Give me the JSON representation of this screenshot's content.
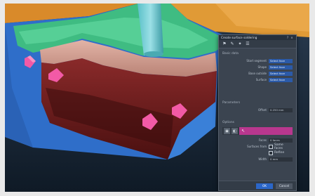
{
  "dialog": {
    "title": "Create surface soldering",
    "controls": [
      "?",
      "×"
    ],
    "toolbar": [
      "flag-icon",
      "pin-icon",
      "wrench-icon",
      "list-icon"
    ],
    "sections": {
      "main": {
        "header": "Basic data",
        "rows": [
          {
            "label": "Start segment",
            "value": "Select face"
          },
          {
            "label": "Shape",
            "value": "Select face"
          },
          {
            "label": "Base outside",
            "value": "Select face"
          },
          {
            "label": "Surface",
            "value": "Select face"
          }
        ]
      },
      "parameters": {
        "header": "Parameters",
        "rows": [
          {
            "label": "Offset",
            "value": "0.250 mm"
          }
        ]
      },
      "options": {
        "header": "Options",
        "selector_glyph": "↖",
        "rows": [
          {
            "label": "Faces",
            "value": "0 faces"
          }
        ],
        "checkbox_label": "Surfaces from",
        "checkbox_value": "Same faces",
        "extra_label": "Refine",
        "width_label": "Width",
        "width_value": "0 mm"
      }
    },
    "buttons": {
      "ok": "OK",
      "cancel": "Cancel"
    }
  }
}
